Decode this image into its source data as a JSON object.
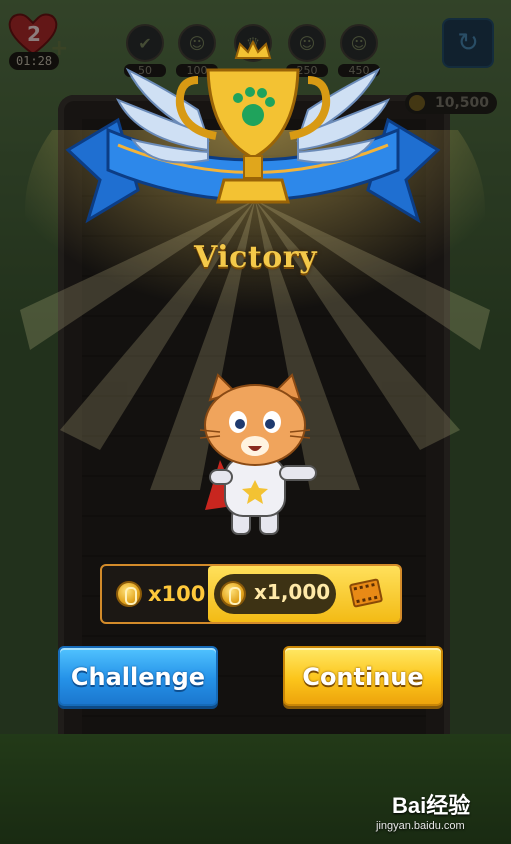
{
  "hud": {
    "lives": "2",
    "timer": "01:28",
    "coins": "10,500",
    "levels": [
      {
        "value": "50",
        "icon": "check-icon"
      },
      {
        "value": "100",
        "icon": "cat-face-icon"
      },
      {
        "value": "",
        "icon": "crown-icon"
      },
      {
        "value": "250",
        "icon": "cat-face-icon"
      },
      {
        "value": "450",
        "icon": "cat-face-icon"
      }
    ]
  },
  "result": {
    "title": "Victory"
  },
  "rewards": {
    "base": "x100",
    "ad_bonus": "x1,000"
  },
  "buttons": {
    "challenge": "Challenge",
    "continue": "Continue"
  },
  "watermark": {
    "brand": "Bai经验",
    "url": "jingyan.baidu.com"
  },
  "colors": {
    "gold": "#f4c94a",
    "challenge_blue": "#2592e8",
    "continue_yellow": "#fcc51b"
  }
}
